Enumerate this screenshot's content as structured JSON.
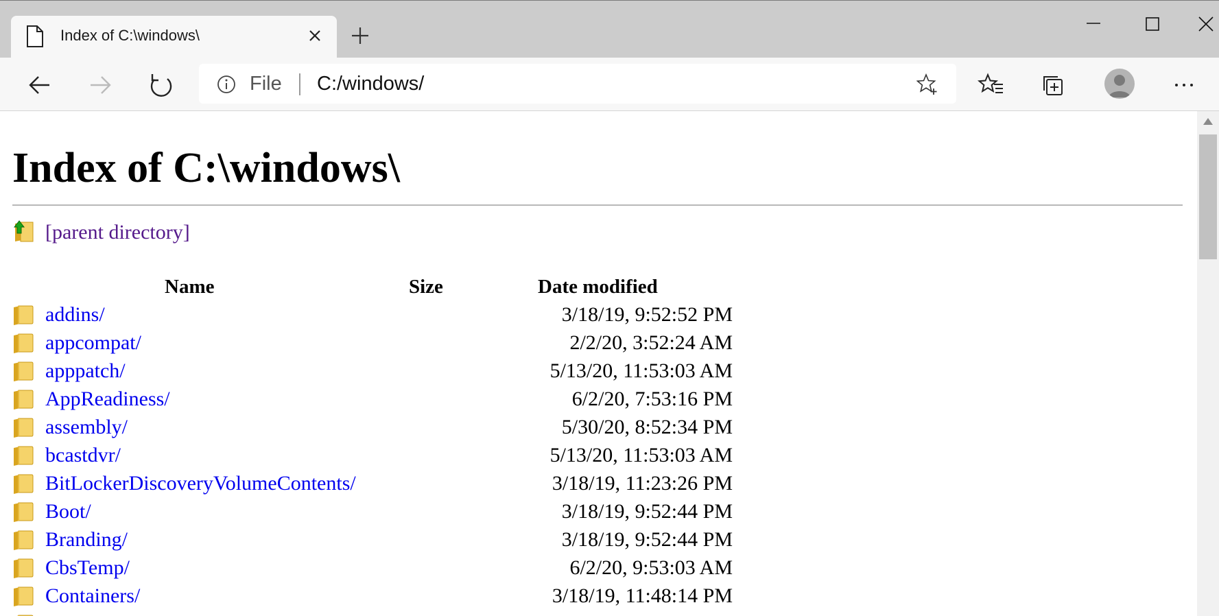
{
  "browser": {
    "tab": {
      "title": "Index of C:\\windows\\",
      "icon": "page-icon"
    },
    "address": {
      "scheme": "File",
      "url": "C:/windows/"
    },
    "icons": [
      "back-icon",
      "forward-icon",
      "refresh-icon",
      "info-icon",
      "add-favorite-icon",
      "favorites-icon",
      "collections-icon",
      "profile-icon",
      "more-icon",
      "minimize-icon",
      "maximize-icon",
      "close-window-icon",
      "new-tab-icon",
      "close-tab-icon"
    ]
  },
  "page": {
    "heading": "Index of C:\\windows\\",
    "parent_link": "[parent directory]",
    "columns": {
      "name": "Name",
      "size": "Size",
      "date": "Date modified"
    },
    "entries": [
      {
        "name": "addins/",
        "size": "",
        "date": "3/18/19, 9:52:52 PM"
      },
      {
        "name": "appcompat/",
        "size": "",
        "date": "2/2/20, 3:52:24 AM"
      },
      {
        "name": "apppatch/",
        "size": "",
        "date": "5/13/20, 11:53:03 AM"
      },
      {
        "name": "AppReadiness/",
        "size": "",
        "date": "6/2/20, 7:53:16 PM"
      },
      {
        "name": "assembly/",
        "size": "",
        "date": "5/30/20, 8:52:34 PM"
      },
      {
        "name": "bcastdvr/",
        "size": "",
        "date": "5/13/20, 11:53:03 AM"
      },
      {
        "name": "BitLockerDiscoveryVolumeContents/",
        "size": "",
        "date": "3/18/19, 11:23:26 PM"
      },
      {
        "name": "Boot/",
        "size": "",
        "date": "3/18/19, 9:52:44 PM"
      },
      {
        "name": "Branding/",
        "size": "",
        "date": "3/18/19, 9:52:44 PM"
      },
      {
        "name": "CbsTemp/",
        "size": "",
        "date": "6/2/20, 9:53:03 AM"
      },
      {
        "name": "Containers/",
        "size": "",
        "date": "3/18/19, 11:48:14 PM"
      },
      {
        "name": "",
        "size": "",
        "date": ""
      }
    ]
  },
  "colors": {
    "link": "#0000ee",
    "visited_link": "#551a8b",
    "chrome_bg": "#cccccc",
    "toolbar_bg": "#f7f7f7"
  }
}
